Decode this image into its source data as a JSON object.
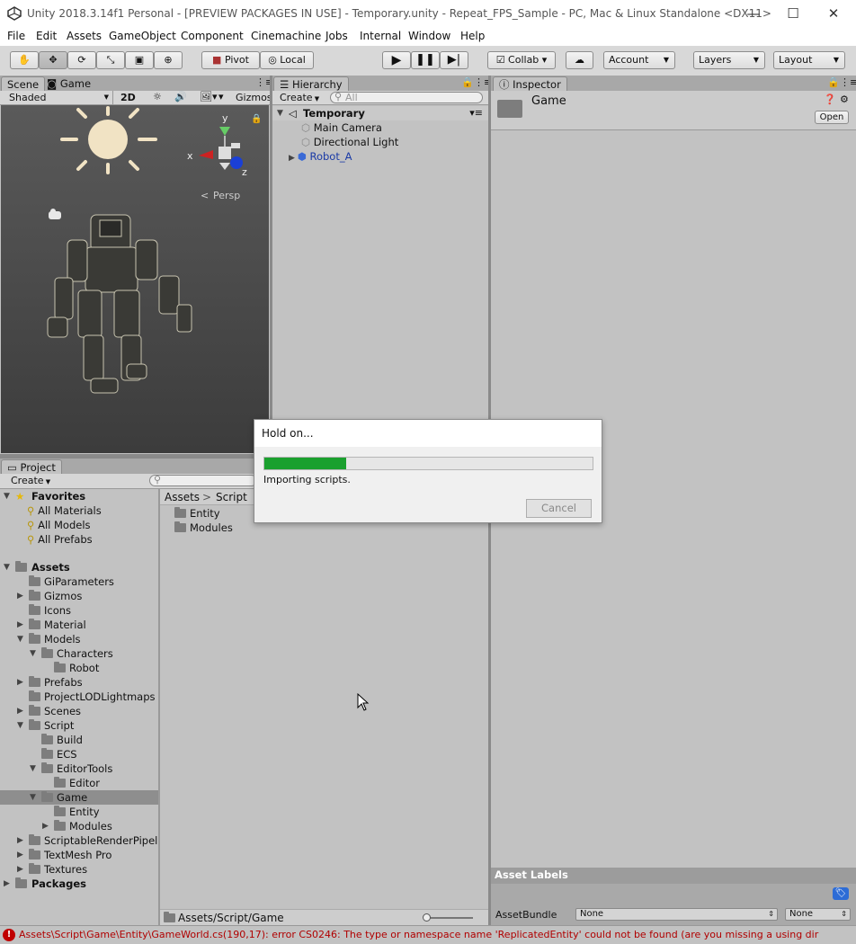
{
  "window": {
    "title": "Unity 2018.3.14f1 Personal - [PREVIEW PACKAGES IN USE] - Temporary.unity - Repeat_FPS_Sample - PC, Mac & Linux Standalone <DX11>",
    "min": "—",
    "max": "☐",
    "close": "✕"
  },
  "menu": [
    "File",
    "Edit",
    "Assets",
    "GameObject",
    "Component",
    "Cinemachine",
    "Jobs",
    "Internal",
    "Window",
    "Help"
  ],
  "toolbar": {
    "pivot": "Pivot",
    "local": "Local",
    "collab": "Collab ▾",
    "account": "Account",
    "layers": "Layers",
    "layout": "Layout"
  },
  "scene": {
    "tab_scene": "Scene",
    "tab_game": "Game",
    "shading": "Shaded",
    "mode_2d": "2D",
    "gizmos": "Gizmos",
    "persp": "Persp",
    "axis_x": "x",
    "axis_y": "y",
    "axis_z": "z"
  },
  "hierarchy": {
    "tab": "Hierarchy",
    "create": "Create",
    "search_placeholder": "All",
    "scene_name": "Temporary",
    "items": [
      "Main Camera",
      "Directional Light",
      "Robot_A"
    ]
  },
  "inspector": {
    "tab": "Inspector",
    "object": "Game",
    "open": "Open",
    "asset_labels": "Asset Labels",
    "assetbundle": "AssetBundle",
    "bundle_value": "None",
    "variant_value": "None"
  },
  "project": {
    "tab": "Project",
    "create": "Create",
    "favorites": "Favorites",
    "fav_items": [
      "All Materials",
      "All Models",
      "All Prefabs"
    ],
    "assets_root": "Assets",
    "tree": [
      {
        "label": "GiParameters",
        "arrow": ""
      },
      {
        "label": "Gizmos",
        "arrow": "▶"
      },
      {
        "label": "Icons",
        "arrow": ""
      },
      {
        "label": "Material",
        "arrow": "▶"
      },
      {
        "label": "Models",
        "arrow": "▼"
      },
      {
        "label": "Characters",
        "arrow": "▼"
      },
      {
        "label": "Robot",
        "arrow": ""
      },
      {
        "label": "Prefabs",
        "arrow": "▶"
      },
      {
        "label": "ProjectLODLightmaps",
        "arrow": ""
      },
      {
        "label": "Scenes",
        "arrow": "▶"
      },
      {
        "label": "Script",
        "arrow": "▼"
      },
      {
        "label": "Build",
        "arrow": ""
      },
      {
        "label": "ECS",
        "arrow": ""
      },
      {
        "label": "EditorTools",
        "arrow": "▼"
      },
      {
        "label": "Editor",
        "arrow": ""
      },
      {
        "label": "Game",
        "arrow": "▼"
      },
      {
        "label": "Entity",
        "arrow": ""
      },
      {
        "label": "Modules",
        "arrow": "▶"
      },
      {
        "label": "ScriptableRenderPipeli",
        "arrow": "▶"
      },
      {
        "label": "TextMesh Pro",
        "arrow": "▶"
      },
      {
        "label": "Textures",
        "arrow": "▶"
      }
    ],
    "packages": "Packages",
    "breadcrumb": [
      "Assets",
      ">",
      "Script"
    ],
    "files": [
      "Entity",
      "Modules"
    ],
    "path": "Assets/Script/Game"
  },
  "dialog": {
    "title": "Hold on...",
    "progress": 0.25,
    "status": "Importing scripts.",
    "cancel": "Cancel"
  },
  "console": {
    "message": "Assets\\Script\\Game\\Entity\\GameWorld.cs(190,17): error CS0246: The type or namespace name 'ReplicatedEntity' could not be found (are you missing a using dir"
  },
  "colors": {
    "progress": "#1aa02e",
    "error": "#c00000",
    "selection": "#8e8e8e"
  }
}
